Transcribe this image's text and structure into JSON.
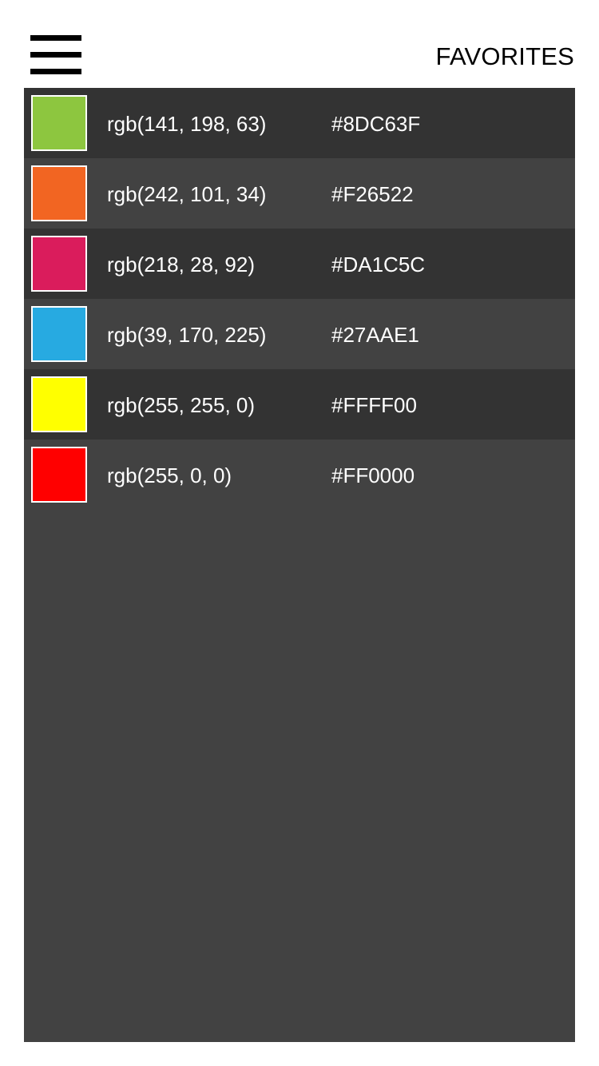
{
  "header": {
    "title": "FAVORITES",
    "menu_icon": "hamburger-menu-icon"
  },
  "favorites": [
    {
      "rgb": "rgb(141, 198, 63)",
      "hex": "#8DC63F",
      "color": "#8DC63F"
    },
    {
      "rgb": "rgb(242, 101, 34)",
      "hex": "#F26522",
      "color": "#F26522"
    },
    {
      "rgb": "rgb(218, 28, 92)",
      "hex": "#DA1C5C",
      "color": "#DA1C5C"
    },
    {
      "rgb": "rgb(39, 170, 225)",
      "hex": "#27AAE1",
      "color": "#27AAE1"
    },
    {
      "rgb": "rgb(255, 255, 0)",
      "hex": "#FFFF00",
      "color": "#FFFF00"
    },
    {
      "rgb": "rgb(255, 0, 0)",
      "hex": "#FF0000",
      "color": "#FF0000"
    }
  ],
  "theme": {
    "row_dark": "#333333",
    "row_light": "#424242",
    "list_background": "#424242",
    "text_color": "#FFFFFF"
  }
}
